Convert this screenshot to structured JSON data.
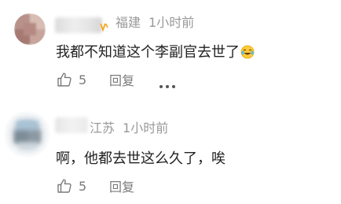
{
  "comments": [
    {
      "location": "福建",
      "time": "1小时前",
      "text": "我都不知道这个李副官去世了",
      "likes": "5",
      "reply_label": "回复",
      "emoji_icon": "crying-laughing-emoji",
      "has_more": true
    },
    {
      "location": "江苏",
      "time": "1小时前",
      "text": "啊，他都去世这么久了，唉",
      "likes": "5",
      "reply_label": "回复",
      "has_more": false
    }
  ],
  "colors": {
    "meta_text": "#999999",
    "body_text": "#222222",
    "action_text": "#7a7a7a",
    "badge": "#f5a623"
  }
}
